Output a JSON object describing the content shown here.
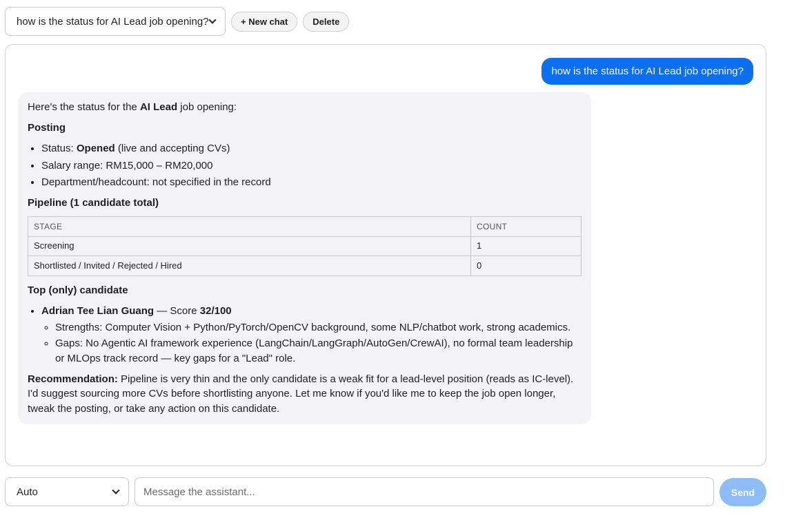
{
  "header": {
    "chat_select_value": "how is the status for AI Lead job opening?",
    "new_chat_label": "+ New chat",
    "delete_label": "Delete"
  },
  "conversation": {
    "user_message": "how is the status for AI Lead job opening?",
    "assistant": {
      "intro_prefix": "Here's the status for the ",
      "intro_bold": "AI Lead",
      "intro_suffix": " job opening:",
      "posting_title": "Posting",
      "posting_items": [
        {
          "prefix": "Status: ",
          "bold": "Opened",
          "suffix": " (live and accepting CVs)"
        },
        {
          "prefix": "Salary range: RM15,000 – RM20,000",
          "bold": "",
          "suffix": ""
        },
        {
          "prefix": "Department/headcount: not specified in the record",
          "bold": "",
          "suffix": ""
        }
      ],
      "pipeline_title": "Pipeline (1 candidate total)",
      "pipeline_table": {
        "headers": [
          "STAGE",
          "COUNT"
        ],
        "rows": [
          [
            "Screening",
            "1"
          ],
          [
            "Shortlisted / Invited / Rejected / Hired",
            "0"
          ]
        ]
      },
      "candidate_title": "Top (only) candidate",
      "candidate": {
        "name": "Adrian Tee Lian Guang",
        "score_prefix": " — Score ",
        "score": "32/100",
        "strengths": "Strengths: Computer Vision + Python/PyTorch/OpenCV background, some NLP/chatbot work, strong academics.",
        "gaps": "Gaps: No Agentic AI framework experience (LangChain/LangGraph/AutoGen/CrewAI), no formal team leadership or MLOps track record — key gaps for a \"Lead\" role."
      },
      "recommendation_label": "Recommendation:",
      "recommendation_text": " Pipeline is very thin and the only candidate is a weak fit for a lead-level position (reads as IC-level). I'd suggest sourcing more CVs before shortlisting anyone. Let me know if you'd like me to keep the job open longer, tweak the posting, or take any action on this candidate."
    }
  },
  "composer": {
    "mode_value": "Auto",
    "input_placeholder": "Message the assistant...",
    "send_label": "Send"
  },
  "colors": {
    "user_bubble": "#0a6ff0",
    "assistant_bubble": "#f3f3f5",
    "send_button": "#8cbdf7"
  }
}
